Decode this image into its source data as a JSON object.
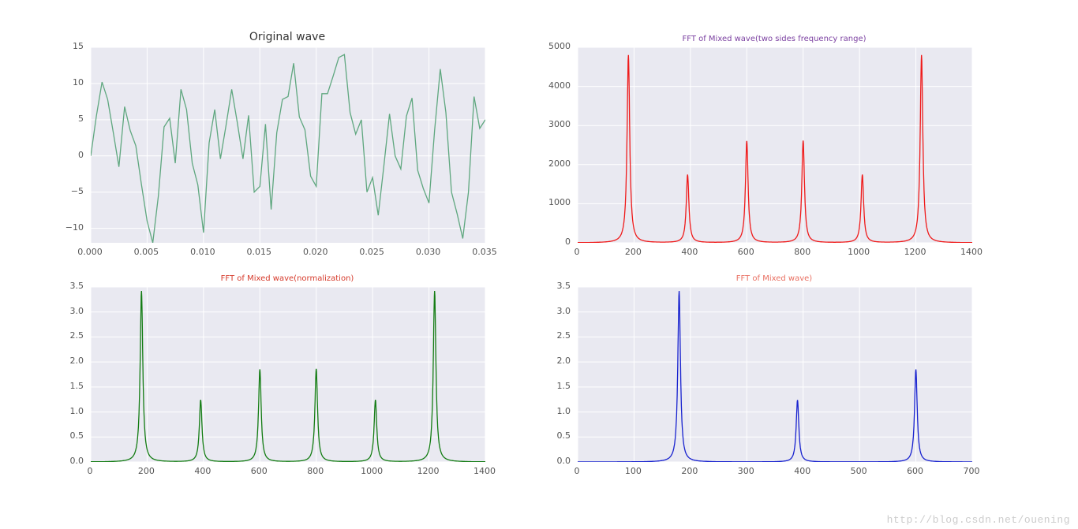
{
  "watermark": "http://blog.csdn.net/ouening",
  "chart_data": [
    {
      "type": "line",
      "title": "Original wave",
      "title_color": "#333333",
      "color": "#5fa77f",
      "xlim": [
        0,
        0.035
      ],
      "ylim": [
        -12,
        15
      ],
      "xticks": [
        0.0,
        0.005,
        0.01,
        0.015,
        0.02,
        0.025,
        0.03,
        0.035
      ],
      "xtick_labels": [
        "0.000",
        "0.005",
        "0.010",
        "0.015",
        "0.020",
        "0.025",
        "0.030",
        "0.035"
      ],
      "yticks": [
        -10,
        -5,
        0,
        5,
        10,
        15
      ],
      "ytick_labels": [
        "−10",
        "−5",
        "0",
        "5",
        "10",
        "15"
      ],
      "x": [
        0.0,
        0.0005,
        0.001,
        0.0015,
        0.002,
        0.0025,
        0.003,
        0.0035,
        0.004,
        0.0045,
        0.005,
        0.0055,
        0.006,
        0.0065,
        0.007,
        0.0075,
        0.008,
        0.0085,
        0.009,
        0.0095,
        0.01,
        0.0105,
        0.011,
        0.0115,
        0.012,
        0.0125,
        0.013,
        0.0135,
        0.014,
        0.0145,
        0.015,
        0.0155,
        0.016,
        0.0165,
        0.017,
        0.0175,
        0.018,
        0.0185,
        0.019,
        0.0195,
        0.02,
        0.0205,
        0.021,
        0.0215,
        0.022,
        0.0225,
        0.023,
        0.0235,
        0.024,
        0.0245,
        0.025,
        0.0255,
        0.026,
        0.0265,
        0.027,
        0.0275,
        0.028,
        0.0285,
        0.029,
        0.0295,
        0.03,
        0.0305,
        0.031,
        0.0315,
        0.032,
        0.0325,
        0.033,
        0.0335,
        0.034,
        0.0345,
        0.035
      ],
      "values": [
        0.0,
        5.5,
        10.2,
        7.8,
        3.2,
        -1.5,
        6.8,
        3.5,
        1.4,
        -4.0,
        -9.0,
        -12.0,
        -5.5,
        4.0,
        5.2,
        -1.0,
        9.2,
        6.4,
        -1.0,
        -4.0,
        -10.6,
        1.8,
        6.4,
        -0.4,
        4.2,
        9.2,
        4.6,
        -0.4,
        5.6,
        -5.0,
        -4.2,
        4.4,
        -7.4,
        3.2,
        7.8,
        8.2,
        12.8,
        5.4,
        3.6,
        -2.8,
        -4.2,
        8.6,
        8.6,
        11.0,
        13.6,
        14.0,
        6.0,
        3.0,
        5.0,
        -5.0,
        -3.0,
        -8.2,
        -1.4,
        5.8,
        0.0,
        -1.8,
        5.5,
        8.0,
        -2.0,
        -4.5,
        -6.5,
        3.5,
        12.0,
        6.0,
        -5.0,
        -8.0,
        -11.4,
        -5.0,
        8.2,
        3.8,
        5.0
      ]
    },
    {
      "type": "line",
      "title": "FFT of Mixed wave(two sides frequency range)",
      "title_color": "#7a3fa0",
      "color": "#ef1a1a",
      "xlim": [
        0,
        1400
      ],
      "ylim": [
        0,
        5000
      ],
      "xticks": [
        0,
        200,
        400,
        600,
        800,
        1000,
        1200,
        1400
      ],
      "xtick_labels": [
        "0",
        "200",
        "400",
        "600",
        "800",
        "1000",
        "1200",
        "1400"
      ],
      "yticks": [
        0,
        1000,
        2000,
        3000,
        4000,
        5000
      ],
      "ytick_labels": [
        "0",
        "1000",
        "2000",
        "3000",
        "4000",
        "5000"
      ],
      "peaks": [
        {
          "x": 180,
          "y": 4800
        },
        {
          "x": 390,
          "y": 1740
        },
        {
          "x": 600,
          "y": 2600
        },
        {
          "x": 800,
          "y": 2610
        },
        {
          "x": 1010,
          "y": 1740
        },
        {
          "x": 1220,
          "y": 4800
        }
      ]
    },
    {
      "type": "line",
      "title": "FFT of Mixed wave(normalization)",
      "title_color": "#d63a2b",
      "color": "#137c13",
      "xlim": [
        0,
        1400
      ],
      "ylim": [
        0,
        3.5
      ],
      "xticks": [
        0,
        200,
        400,
        600,
        800,
        1000,
        1200,
        1400
      ],
      "xtick_labels": [
        "0",
        "200",
        "400",
        "600",
        "800",
        "1000",
        "1200",
        "1400"
      ],
      "yticks": [
        0.0,
        0.5,
        1.0,
        1.5,
        2.0,
        2.5,
        3.0,
        3.5
      ],
      "ytick_labels": [
        "0.0",
        "0.5",
        "1.0",
        "1.5",
        "2.0",
        "2.5",
        "3.0",
        "3.5"
      ],
      "peaks": [
        {
          "x": 180,
          "y": 3.42
        },
        {
          "x": 390,
          "y": 1.24
        },
        {
          "x": 600,
          "y": 1.85
        },
        {
          "x": 800,
          "y": 1.86
        },
        {
          "x": 1010,
          "y": 1.24
        },
        {
          "x": 1220,
          "y": 3.42
        }
      ]
    },
    {
      "type": "line",
      "title": "FFT of Mixed wave)",
      "title_color": "#e97062",
      "color": "#1822cf",
      "xlim": [
        0,
        700
      ],
      "ylim": [
        0,
        3.5
      ],
      "xticks": [
        0,
        100,
        200,
        300,
        400,
        500,
        600,
        700
      ],
      "xtick_labels": [
        "0",
        "100",
        "200",
        "300",
        "400",
        "500",
        "600",
        "700"
      ],
      "yticks": [
        0.0,
        0.5,
        1.0,
        1.5,
        2.0,
        2.5,
        3.0,
        3.5
      ],
      "ytick_labels": [
        "0.0",
        "0.5",
        "1.0",
        "1.5",
        "2.0",
        "2.5",
        "3.0",
        "3.5"
      ],
      "peaks": [
        {
          "x": 180,
          "y": 3.42
        },
        {
          "x": 390,
          "y": 1.24
        },
        {
          "x": 600,
          "y": 1.85
        }
      ]
    }
  ]
}
